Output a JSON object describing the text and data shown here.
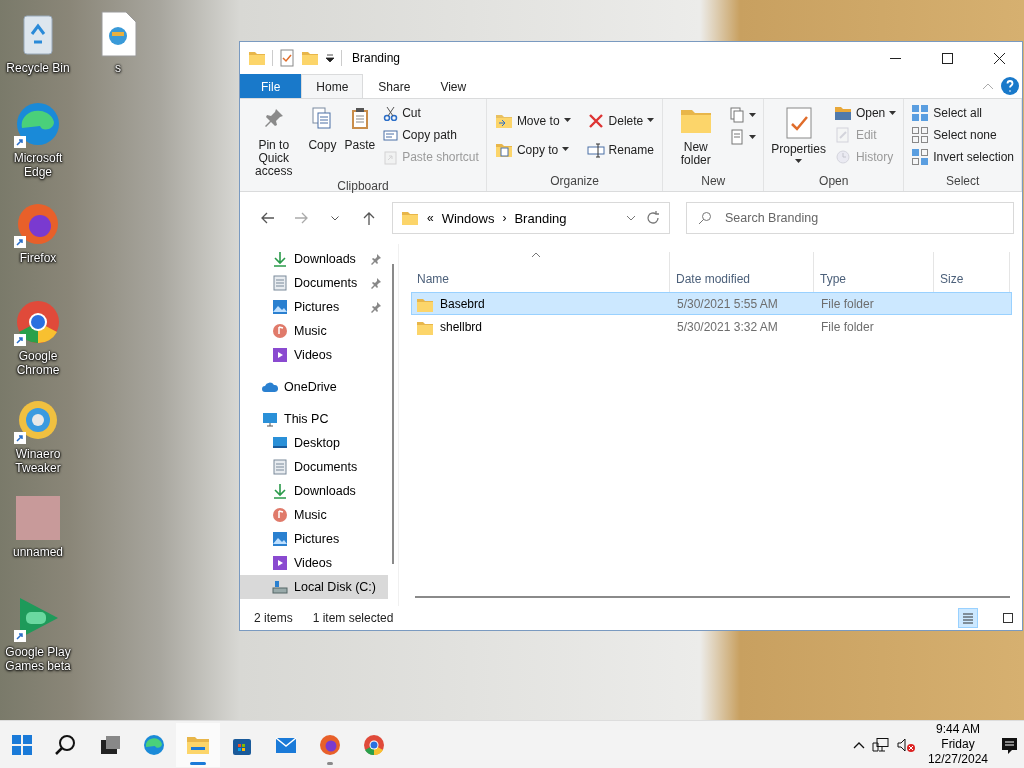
{
  "desktop_icons": [
    {
      "label": "Recycle Bin",
      "kind": "recycle",
      "shortcut": false
    },
    {
      "label": "s",
      "kind": "file",
      "shortcut": false
    },
    {
      "label": "Microsoft Edge",
      "kind": "edge",
      "shortcut": true
    },
    {
      "label": "Firefox",
      "kind": "firefox",
      "shortcut": true
    },
    {
      "label": "Google Chrome",
      "kind": "chrome",
      "shortcut": true
    },
    {
      "label": "Winaero Tweaker",
      "kind": "winaero",
      "shortcut": true
    },
    {
      "label": "unnamed",
      "kind": "picture",
      "shortcut": false
    },
    {
      "label": "Google Play Games beta",
      "kind": "play",
      "shortcut": true
    }
  ],
  "window": {
    "title": "Branding",
    "ribbon_tabs": [
      {
        "label": "File",
        "kind": "file",
        "selected": false
      },
      {
        "label": "Home",
        "kind": "tab",
        "selected": true
      },
      {
        "label": "Share",
        "kind": "tab",
        "selected": false
      },
      {
        "label": "View",
        "kind": "tab",
        "selected": false
      }
    ],
    "ribbon_groups": [
      {
        "label": "Clipboard",
        "commands": [
          {
            "label": "Pin to Quick access",
            "kind": "pin",
            "disabled": false
          },
          {
            "label": "Copy",
            "kind": "copy",
            "disabled": false
          },
          {
            "label": "Paste",
            "kind": "paste",
            "disabled": false
          },
          {
            "label": "Cut",
            "kind": "cut",
            "disabled": false
          },
          {
            "label": "Copy path",
            "kind": "copypath",
            "disabled": false
          },
          {
            "label": "Paste shortcut",
            "kind": "pasteshortcut",
            "disabled": true
          }
        ]
      },
      {
        "label": "Organize",
        "commands": [
          {
            "label": "Move to",
            "kind": "moveto",
            "disabled": false,
            "dropdown": true
          },
          {
            "label": "Copy to",
            "kind": "copyto",
            "disabled": false,
            "dropdown": true
          },
          {
            "label": "Delete",
            "kind": "delete",
            "disabled": false,
            "dropdown": true
          },
          {
            "label": "Rename",
            "kind": "rename",
            "disabled": false,
            "dropdown": false
          }
        ]
      },
      {
        "label": "New",
        "commands": [
          {
            "label": "New folder",
            "kind": "newfolder",
            "disabled": false
          },
          {
            "kind": "newitem",
            "disabled": false,
            "dropdown": true
          },
          {
            "kind": "easyaccess",
            "disabled": false,
            "dropdown": true
          }
        ]
      },
      {
        "label": "Open",
        "commands": [
          {
            "label": "Properties",
            "kind": "properties",
            "disabled": false,
            "dropdown": true
          },
          {
            "label": "Open",
            "kind": "open",
            "disabled": false,
            "dropdown": true
          },
          {
            "label": "Edit",
            "kind": "edit",
            "disabled": true,
            "dropdown": false
          },
          {
            "label": "History",
            "kind": "history",
            "disabled": true,
            "dropdown": false
          }
        ]
      },
      {
        "label": "Select",
        "commands": [
          {
            "label": "Select all",
            "kind": "selectall",
            "disabled": false
          },
          {
            "label": "Select none",
            "kind": "selectnone",
            "disabled": false
          },
          {
            "label": "Invert selection",
            "kind": "invert",
            "disabled": false
          }
        ]
      }
    ],
    "address": {
      "overflow": "«",
      "segments": [
        "Windows",
        "Branding"
      ],
      "separator": "›"
    },
    "search": {
      "placeholder": "Search Branding"
    },
    "navigation": {
      "quick_access": [
        {
          "label": "Downloads",
          "kind": "download",
          "pinned": true,
          "selected": false
        },
        {
          "label": "Documents",
          "kind": "document",
          "pinned": true,
          "selected": false
        },
        {
          "label": "Pictures",
          "kind": "picture",
          "pinned": true,
          "selected": false
        },
        {
          "label": "Music",
          "kind": "music",
          "pinned": false,
          "selected": false
        },
        {
          "label": "Videos",
          "kind": "video",
          "pinned": false,
          "selected": false
        }
      ],
      "roots": [
        {
          "label": "OneDrive",
          "kind": "cloud",
          "selected": false
        },
        {
          "label": "This PC",
          "kind": "pc",
          "selected": false,
          "children": [
            {
              "label": "Desktop",
              "kind": "desktop",
              "selected": false
            },
            {
              "label": "Documents",
              "kind": "document",
              "selected": false
            },
            {
              "label": "Downloads",
              "kind": "download",
              "selected": false
            },
            {
              "label": "Music",
              "kind": "music",
              "selected": false
            },
            {
              "label": "Pictures",
              "kind": "picture",
              "selected": false
            },
            {
              "label": "Videos",
              "kind": "video",
              "selected": false
            },
            {
              "label": "Local Disk (C:)",
              "kind": "disk",
              "selected": true
            }
          ]
        }
      ]
    },
    "table": {
      "columns": [
        {
          "label": "Name",
          "sorted": true
        },
        {
          "label": "Date modified",
          "sorted": false
        },
        {
          "label": "Type",
          "sorted": false
        },
        {
          "label": "Size",
          "sorted": false
        }
      ],
      "rows": [
        {
          "name": "Basebrd",
          "date_modified": "5/30/2021 5:55 AM",
          "type": "File folder",
          "selected": true
        },
        {
          "name": "shellbrd",
          "date_modified": "5/30/2021 3:32 AM",
          "type": "File folder",
          "selected": false
        }
      ]
    },
    "status_bar": {
      "item_count": "2 items",
      "selection": "1 item selected"
    },
    "view_buttons": [
      {
        "kind": "details",
        "selected": true
      },
      {
        "kind": "large_icons",
        "selected": false
      }
    ]
  },
  "taskbar": {
    "buttons": [
      {
        "kind": "start",
        "active": false,
        "running": false
      },
      {
        "kind": "search",
        "active": false,
        "running": false
      },
      {
        "kind": "taskview",
        "active": false,
        "running": false
      },
      {
        "kind": "edge",
        "active": false,
        "running": false
      },
      {
        "kind": "explorer",
        "active": true,
        "running": true
      },
      {
        "kind": "store",
        "active": false,
        "running": false
      },
      {
        "kind": "mail",
        "active": false,
        "running": false
      },
      {
        "kind": "firefox",
        "active": false,
        "running": true
      },
      {
        "kind": "chrome",
        "active": false,
        "running": false
      }
    ],
    "volume_muted": true,
    "clock": {
      "time": "9:44 AM",
      "day": "Friday",
      "date": "12/27/2024"
    }
  }
}
